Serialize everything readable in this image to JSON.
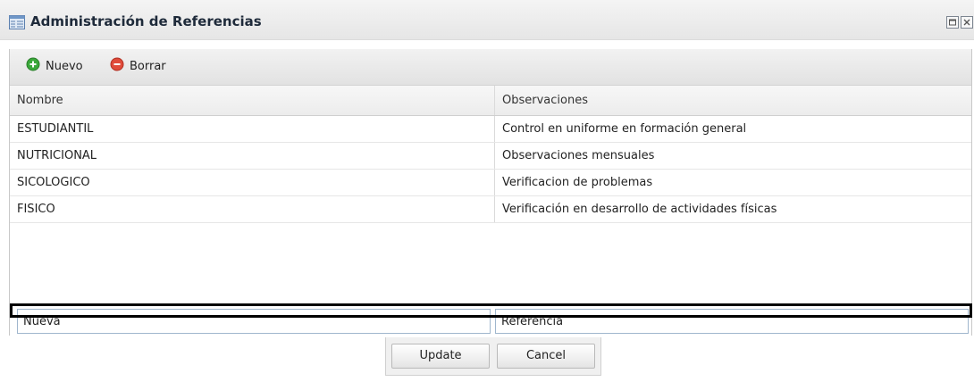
{
  "window": {
    "title": "Administración de Referencias",
    "title_icon": "window-grid-icon",
    "controls": [
      "maximize-icon",
      "close-icon"
    ]
  },
  "toolbar": {
    "new_label": "Nuevo",
    "new_icon": "add-circle-icon",
    "delete_label": "Borrar",
    "delete_icon": "remove-circle-icon"
  },
  "grid": {
    "columns": [
      "Nombre",
      "Observaciones"
    ],
    "rows": [
      {
        "nombre": "ESTUDIANTIL",
        "observaciones": "Control en uniforme en formación general"
      },
      {
        "nombre": "NUTRICIONAL",
        "observaciones": "Observaciones mensuales"
      },
      {
        "nombre": "SICOLOGICO",
        "observaciones": "Verificacion de problemas"
      },
      {
        "nombre": "FISICO",
        "observaciones": "Verificación en desarrollo de actividades físicas"
      }
    ]
  },
  "editor": {
    "nombre_value": "Nueva",
    "observaciones_value": "Referencia",
    "update_label": "Update",
    "cancel_label": "Cancel"
  },
  "colors": {
    "add": "#3aa83a",
    "remove": "#e04b3a",
    "input_border": "#9fb6cd",
    "highlight": "#000000"
  }
}
